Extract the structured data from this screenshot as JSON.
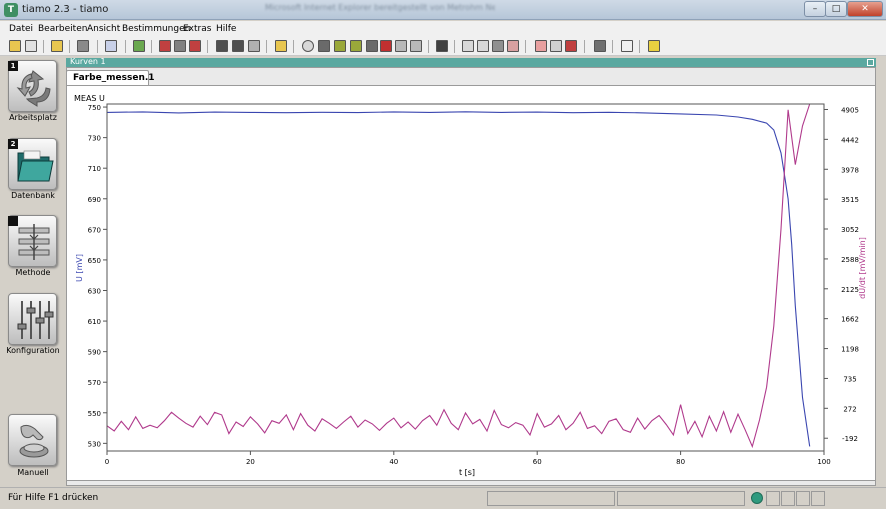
{
  "window": {
    "title": "tiamo 2.3 - tiamo",
    "app_icon": "T",
    "blurred_title": "Microsoft Internet Explorer bereitgestellt von Metrohm Netzwerk"
  },
  "menu": [
    "Datei",
    "Bearbeiten",
    "Ansicht",
    "Bestimmungen",
    "Extras",
    "Hilfe"
  ],
  "nav": [
    {
      "num": "1",
      "label": "Arbeitsplatz",
      "icon": "recycle-arrows-icon"
    },
    {
      "num": "2",
      "label": "Datenbank",
      "icon": "folder-icon"
    },
    {
      "num": "",
      "label": "Methode",
      "icon": "method-sliders-icon"
    },
    {
      "num": "",
      "label": "Konfiguration",
      "icon": "config-sliders-icon"
    },
    {
      "num": "",
      "label": "Manuell",
      "icon": "hand-button-icon"
    }
  ],
  "panel": {
    "title": "Kurven 1",
    "tab": "Farbe_messen.1"
  },
  "status": {
    "help": "Für Hilfe F1 drücken",
    "led_color": "#2f9a7e"
  },
  "chart_data": {
    "type": "line",
    "title": "MEAS U",
    "xlabel": "t [s]",
    "ylabel": "U [mV]",
    "y2label": "dU/dt [mV/min]",
    "xlim": [
      0,
      100
    ],
    "ylim": [
      525,
      752
    ],
    "y2lim": [
      -390,
      4990
    ],
    "x_ticks": [
      "0",
      "20",
      "40",
      "60",
      "80",
      "100"
    ],
    "y_ticks": [
      "530",
      "550",
      "570",
      "590",
      "610",
      "630",
      "650",
      "670",
      "690",
      "710",
      "730",
      "750"
    ],
    "y2_ticks": [
      "-192",
      "272",
      "735",
      "1198",
      "1662",
      "2125",
      "2588",
      "3052",
      "3515",
      "3978",
      "4442",
      "4905"
    ],
    "series": [
      {
        "name": "U",
        "axis": "left",
        "color": "#3a46b0",
        "x": [
          0,
          5,
          10,
          15,
          20,
          25,
          30,
          35,
          40,
          45,
          50,
          55,
          60,
          65,
          70,
          75,
          80,
          85,
          88,
          90,
          92,
          93,
          94,
          94.5,
          95,
          95.5,
          96,
          97,
          98
        ],
        "y": [
          746.5,
          746.8,
          746.2,
          746.7,
          746.5,
          746.3,
          746.6,
          746.4,
          746.8,
          746.5,
          746.9,
          746.5,
          746.7,
          746.3,
          746.6,
          746.2,
          745.5,
          744.8,
          743.5,
          742,
          739.5,
          735,
          720,
          705,
          690,
          660,
          620,
          560,
          528
        ]
      },
      {
        "name": "dU/dt",
        "axis": "right",
        "color": "#b03a8c",
        "x": [
          0,
          1,
          2,
          3,
          4,
          5,
          6,
          7,
          8,
          9,
          10,
          11,
          12,
          13,
          14,
          15,
          16,
          17,
          18,
          19,
          20,
          21,
          22,
          23,
          24,
          25,
          26,
          27,
          28,
          29,
          30,
          31,
          32,
          33,
          34,
          35,
          36,
          37,
          38,
          39,
          40,
          41,
          42,
          43,
          44,
          45,
          46,
          47,
          48,
          49,
          50,
          51,
          52,
          53,
          54,
          55,
          56,
          57,
          58,
          59,
          60,
          61,
          62,
          63,
          64,
          65,
          66,
          67,
          68,
          69,
          70,
          71,
          72,
          73,
          74,
          75,
          76,
          77,
          78,
          79,
          80,
          81,
          82,
          83,
          84,
          85,
          86,
          87,
          88,
          89,
          90,
          91,
          92,
          93,
          94,
          95,
          96,
          97,
          98
        ],
        "y": [
          0,
          -80,
          70,
          -60,
          140,
          -40,
          10,
          -30,
          80,
          210,
          120,
          40,
          -20,
          150,
          20,
          210,
          170,
          -120,
          60,
          -10,
          140,
          30,
          -110,
          80,
          40,
          170,
          -60,
          190,
          10,
          -80,
          110,
          40,
          -40,
          60,
          150,
          -20,
          90,
          30,
          -70,
          40,
          120,
          -30,
          60,
          -50,
          80,
          160,
          10,
          250,
          40,
          -60,
          200,
          30,
          100,
          -80,
          240,
          20,
          -30,
          50,
          10,
          -140,
          190,
          -20,
          30,
          160,
          -60,
          40,
          210,
          -40,
          0,
          -120,
          70,
          110,
          -60,
          -100,
          120,
          -50,
          80,
          160,
          20,
          -140,
          330,
          -120,
          70,
          -170,
          150,
          -80,
          220,
          -100,
          180,
          -60,
          -320,
          90,
          600,
          1550,
          3050,
          4900,
          4050,
          4650,
          5100
        ]
      }
    ]
  }
}
